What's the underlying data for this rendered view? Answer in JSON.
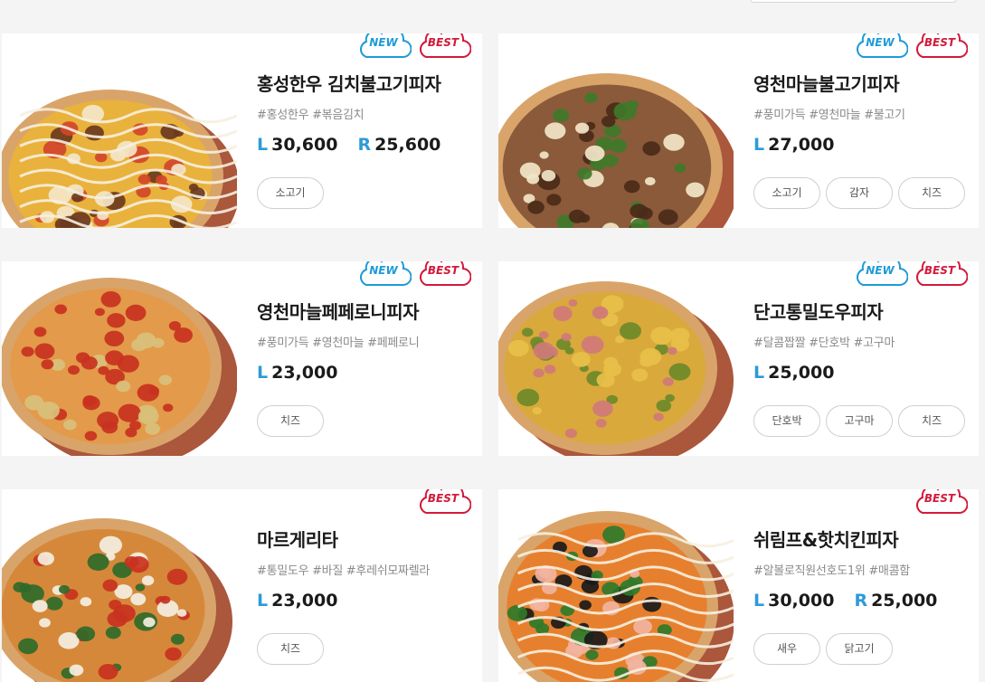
{
  "products": [
    {
      "name": "홍성한우 김치불고기피자",
      "tags": "#홍성한우 #볶음김치",
      "prices": [
        {
          "size": "L",
          "amount": "30,600"
        },
        {
          "size": "R",
          "amount": "25,600"
        }
      ],
      "toppings": [
        "소고기"
      ],
      "badges": [
        "NEW",
        "BEST"
      ],
      "image": "pizza-image"
    },
    {
      "name": "영천마늘불고기피자",
      "tags": "#풍미가득 #영천마늘 #불고기",
      "prices": [
        {
          "size": "L",
          "amount": "27,000"
        }
      ],
      "toppings": [
        "소고기",
        "감자",
        "치즈"
      ],
      "badges": [
        "NEW",
        "BEST"
      ],
      "image": "pizza-image"
    },
    {
      "name": "영천마늘페페로니피자",
      "tags": "#풍미가득 #영천마늘 #페페로니",
      "prices": [
        {
          "size": "L",
          "amount": "23,000"
        }
      ],
      "toppings": [
        "치즈"
      ],
      "badges": [
        "NEW",
        "BEST"
      ],
      "image": "pizza-image"
    },
    {
      "name": "단고통밀도우피자",
      "tags": "#달콤짭짤 #단호박 #고구마",
      "prices": [
        {
          "size": "L",
          "amount": "25,000"
        }
      ],
      "toppings": [
        "단호박",
        "고구마",
        "치즈"
      ],
      "badges": [
        "NEW",
        "BEST"
      ],
      "image": "pizza-image"
    },
    {
      "name": "마르게리타",
      "tags": "#통밀도우 #바질 #후레쉬모짜렐라",
      "prices": [
        {
          "size": "L",
          "amount": "23,000"
        }
      ],
      "toppings": [
        "치즈"
      ],
      "badges": [
        "BEST"
      ],
      "image": "pizza-image"
    },
    {
      "name": "쉬림프&핫치킨피자",
      "tags": "#알볼로직원선호도1위 #매콤함",
      "prices": [
        {
          "size": "L",
          "amount": "30,000"
        },
        {
          "size": "R",
          "amount": "25,000"
        }
      ],
      "toppings": [
        "새우",
        "닭고기"
      ],
      "badges": [
        "BEST"
      ],
      "image": "pizza-image"
    }
  ],
  "colors": {
    "new_badge": "#1e9bd7",
    "best_badge": "#d21a3a",
    "size_label": "#2e9ad8",
    "background": "#f4f4f4"
  }
}
